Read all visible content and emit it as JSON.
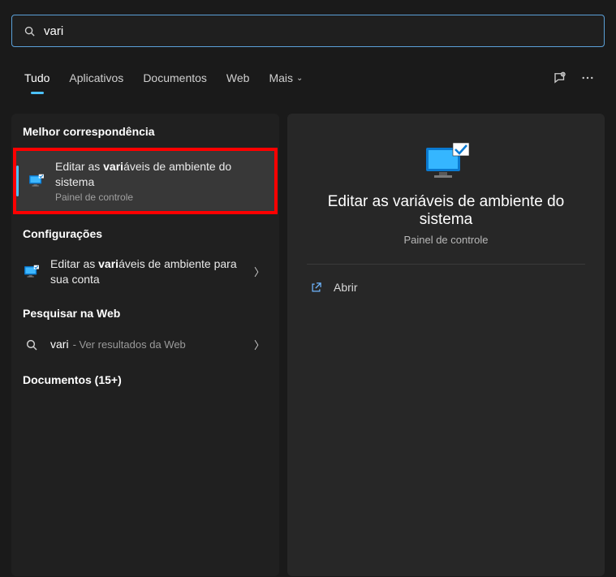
{
  "search": {
    "query": "vari"
  },
  "tabs": {
    "all": "Tudo",
    "apps": "Aplicativos",
    "docs": "Documentos",
    "web": "Web",
    "more": "Mais"
  },
  "sections": {
    "best_match": "Melhor correspondência",
    "settings": "Configurações",
    "search_web": "Pesquisar na Web",
    "documents": "Documentos (15+)"
  },
  "results": {
    "best": {
      "title_pre": "Editar as ",
      "title_bold": "vari",
      "title_post": "áveis de ambiente do sistema",
      "subtitle": "Painel de controle"
    },
    "settings1": {
      "title_pre": "Editar as ",
      "title_bold": "vari",
      "title_post": "áveis de ambiente para sua conta"
    },
    "web1": {
      "query": "vari",
      "suffix": "- Ver resultados da Web"
    }
  },
  "detail": {
    "title": "Editar as variáveis de ambiente do sistema",
    "subtitle": "Painel de controle",
    "open_label": "Abrir"
  }
}
